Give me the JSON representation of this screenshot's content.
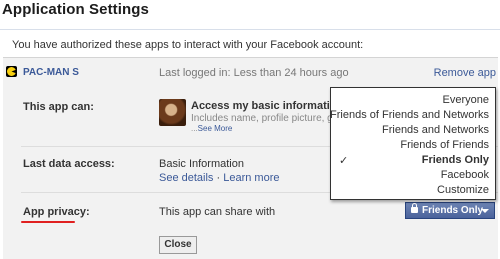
{
  "header": {
    "title": "Application Settings"
  },
  "intro_text": "You have authorized these apps to interact with your Facebook account:",
  "app": {
    "name": "PAC-MAN S",
    "last_login": "Last logged in: Less than 24 hours ago",
    "remove_label": "Remove app"
  },
  "permissions": {
    "label": "This app can:",
    "title": "Access my basic information",
    "description": "Includes name, profile picture, gen",
    "see_more_prefix": "...",
    "see_more_link": "See More"
  },
  "data_access": {
    "label": "Last data access:",
    "value": "Basic Information",
    "see_details": "See details",
    "separator": " · ",
    "learn_more": "Learn more"
  },
  "privacy": {
    "label": "App privacy:",
    "share_text": "This app can share with",
    "button_label": "Friends Only",
    "options": [
      {
        "label": "Everyone",
        "selected": false
      },
      {
        "label": "Friends of Friends and Networks",
        "selected": false
      },
      {
        "label": "Friends and Networks",
        "selected": false
      },
      {
        "label": "Friends of Friends",
        "selected": false
      },
      {
        "label": "Friends Only",
        "selected": true
      },
      {
        "label": "Facebook",
        "selected": false
      },
      {
        "label": "Customize",
        "selected": false
      }
    ],
    "check_glyph": "✓"
  },
  "close_label": "Close",
  "colors": {
    "link": "#3b5998",
    "button": "#5b74a8",
    "panel": "#f2f2f2",
    "annotation_underline": "#e02020"
  }
}
